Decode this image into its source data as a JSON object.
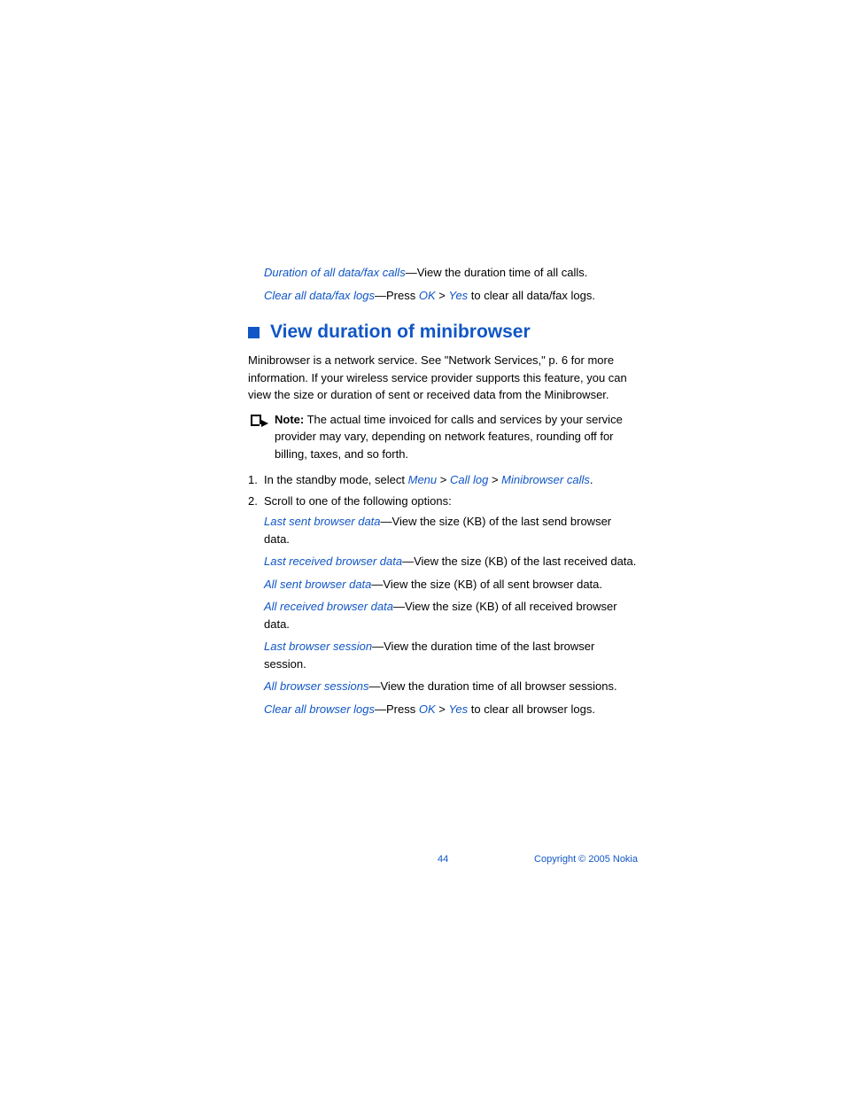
{
  "top": {
    "duration_all_label": "Duration of all data/fax calls",
    "duration_all_rest": "—View the duration time of all calls.",
    "clear_all_label": "Clear all data/fax logs",
    "clear_all_mid1": "—Press ",
    "ok": "OK",
    "gt": " > ",
    "yes": "Yes",
    "clear_all_end": " to clear all data/fax logs."
  },
  "heading": "View duration of minibrowser",
  "intro": "Minibrowser is a network service. See \"Network Services,\" p. 6 for more information. If your wireless service provider supports this feature, you can view the size or duration of sent or received data from the Minibrowser.",
  "note": {
    "label": "Note:",
    "body": " The actual time invoiced for calls and services by your service provider may vary, depending on network features, rounding off for billing, taxes, and so forth."
  },
  "step1": {
    "num": "1.",
    "pre": "In the standby mode, select ",
    "menu": "Menu",
    "gt": " > ",
    "calllog": "Call log",
    "minibrowser": "Minibrowser calls",
    "post": "."
  },
  "step2": {
    "num": "2.",
    "text": "Scroll to one of the following options:"
  },
  "opts": {
    "a_label": "Last sent browser data",
    "a_rest": "—View the size (KB) of the last send browser data.",
    "b_label": "Last received browser data",
    "b_rest": "—View the size (KB) of the last received data.",
    "c_label": "All sent browser data",
    "c_rest": "—View the size (KB) of all sent browser data.",
    "d_label": "All received browser data",
    "d_rest": "—View the size (KB) of all received browser data.",
    "e_label": "Last browser session",
    "e_rest": "—View the duration time of the last browser session.",
    "f_label": "All browser sessions",
    "f_rest": "—View the duration time of all browser sessions.",
    "g_label": "Clear all browser logs",
    "g_mid1": "—Press ",
    "g_ok": "OK",
    "g_gt": " > ",
    "g_yes": "Yes",
    "g_end": " to clear all browser logs."
  },
  "footer": {
    "page": "44",
    "copyright": "Copyright © 2005 Nokia"
  }
}
